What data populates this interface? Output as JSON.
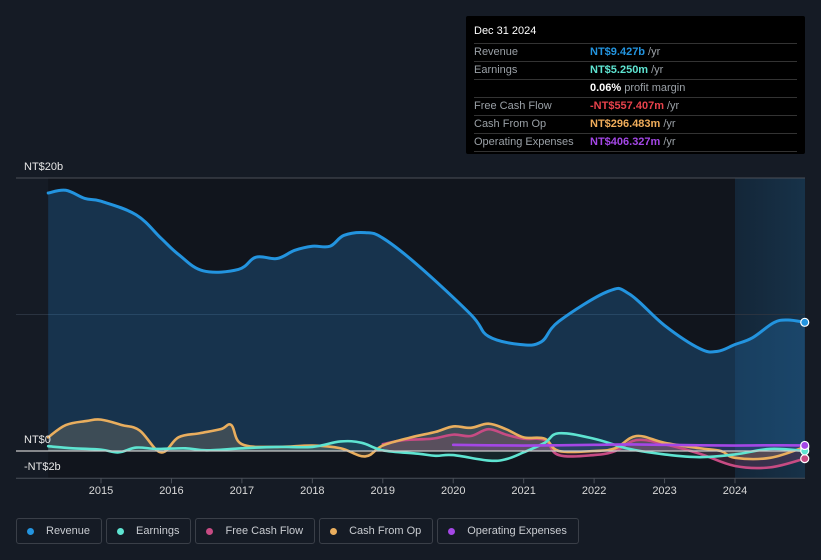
{
  "tooltip": {
    "date": "Dec 31 2024",
    "rows": [
      {
        "label": "Revenue",
        "value": "NT$9.427b",
        "unit": "/yr",
        "color": "#2394df"
      },
      {
        "label": "Earnings",
        "value": "NT$5.250m",
        "unit": "/yr",
        "color": "#5ee4d1"
      },
      {
        "label": "",
        "value": "0.06%",
        "unit": "profit margin",
        "color": "#ffffff"
      },
      {
        "label": "Free Cash Flow",
        "value": "-NT$557.407m",
        "unit": "/yr",
        "color": "#e8424b"
      },
      {
        "label": "Cash From Op",
        "value": "NT$296.483m",
        "unit": "/yr",
        "color": "#f0ad5b"
      },
      {
        "label": "Operating Expenses",
        "value": "NT$406.327m",
        "unit": "/yr",
        "color": "#a447e6"
      }
    ]
  },
  "legend": [
    {
      "label": "Revenue",
      "color": "#2394df"
    },
    {
      "label": "Earnings",
      "color": "#5ee4d1"
    },
    {
      "label": "Free Cash Flow",
      "color": "#c74b83"
    },
    {
      "label": "Cash From Op",
      "color": "#e9ae5e"
    },
    {
      "label": "Operating Expenses",
      "color": "#a447e6"
    }
  ],
  "chart_data": {
    "type": "line",
    "title": "",
    "xlabel": "",
    "ylabel": "",
    "unit": "NT$ billions",
    "xlim": [
      2014.25,
      2025.0
    ],
    "ylim": [
      -2,
      20
    ],
    "y_tick_labels": [
      {
        "value": 20,
        "label": "NT$20b"
      },
      {
        "value": 0,
        "label": "NT$0"
      },
      {
        "value": -2,
        "label": "-NT$2b"
      }
    ],
    "x_ticks": [
      2015,
      2016,
      2017,
      2018,
      2019,
      2020,
      2021,
      2022,
      2023,
      2024
    ],
    "x_tick_labels": [
      "2015",
      "2016",
      "2017",
      "2018",
      "2019",
      "2020",
      "2021",
      "2022",
      "2023",
      "2024"
    ],
    "grid": true,
    "legend_position": "bottom",
    "highlight_start": 2024.0,
    "series": [
      {
        "name": "Revenue",
        "color": "#2394df",
        "fill": true,
        "x": [
          2014.25,
          2014.5,
          2014.77,
          2015.0,
          2015.5,
          2015.85,
          2016.1,
          2016.45,
          2016.95,
          2017.2,
          2017.5,
          2017.75,
          2018.0,
          2018.25,
          2018.45,
          2018.75,
          2019.0,
          2019.5,
          2020.25,
          2020.5,
          2020.95,
          2021.25,
          2021.5,
          2022.2,
          2022.5,
          2023.0,
          2023.5,
          2023.75,
          2024.0,
          2024.25,
          2024.55,
          2024.75,
          2024.99
        ],
        "values": [
          18.9,
          19.1,
          18.5,
          18.3,
          17.3,
          15.6,
          14.4,
          13.2,
          13.3,
          14.2,
          14.1,
          14.7,
          15.0,
          15.0,
          15.8,
          16.0,
          15.6,
          13.6,
          10.0,
          8.4,
          7.8,
          8.0,
          9.5,
          11.7,
          11.5,
          9.2,
          7.5,
          7.3,
          7.8,
          8.3,
          9.4,
          9.6,
          9.427
        ]
      },
      {
        "name": "Earnings",
        "color": "#5ee4d1",
        "fill": false,
        "x": [
          2014.25,
          2014.6,
          2015.0,
          2015.25,
          2015.5,
          2015.8,
          2016.2,
          2016.5,
          2017.0,
          2017.5,
          2018.0,
          2018.4,
          2018.7,
          2019.0,
          2019.5,
          2019.75,
          2020.0,
          2020.5,
          2020.75,
          2021.0,
          2021.3,
          2021.5,
          2022.0,
          2022.5,
          2023.0,
          2023.5,
          2024.0,
          2024.5,
          2024.99
        ],
        "values": [
          0.35,
          0.2,
          0.1,
          -0.1,
          0.25,
          0.15,
          0.2,
          0.05,
          0.2,
          0.3,
          0.3,
          0.7,
          0.6,
          0.05,
          -0.2,
          -0.35,
          -0.3,
          -0.7,
          -0.6,
          -0.1,
          0.6,
          1.3,
          0.9,
          0.15,
          -0.25,
          -0.45,
          -0.25,
          0.15,
          0.005
        ]
      },
      {
        "name": "Free Cash Flow",
        "color": "#c74b83",
        "fill": false,
        "x": [
          2019.0,
          2019.3,
          2019.7,
          2020.0,
          2020.25,
          2020.5,
          2020.75,
          2021.0,
          2021.3,
          2021.5,
          2022.0,
          2022.3,
          2022.6,
          2023.0,
          2023.5,
          2024.0,
          2024.5,
          2024.99
        ],
        "values": [
          0.5,
          0.8,
          0.9,
          1.2,
          1.1,
          1.6,
          1.2,
          0.9,
          0.8,
          -0.3,
          -0.3,
          0.0,
          0.8,
          0.5,
          -0.2,
          -1.1,
          -1.2,
          -0.557
        ]
      },
      {
        "name": "Cash From Op",
        "color": "#e9ae5e",
        "fill": false,
        "x": [
          2014.25,
          2014.5,
          2014.8,
          2015.0,
          2015.3,
          2015.55,
          2015.85,
          2016.1,
          2016.4,
          2016.7,
          2016.85,
          2017.0,
          2017.5,
          2018.0,
          2018.4,
          2018.75,
          2019.0,
          2019.4,
          2019.75,
          2020.0,
          2020.25,
          2020.5,
          2020.75,
          2021.0,
          2021.3,
          2021.5,
          2022.0,
          2022.3,
          2022.6,
          2023.0,
          2023.5,
          2023.8,
          2024.0,
          2024.5,
          2024.99
        ],
        "values": [
          1.0,
          1.9,
          2.2,
          2.3,
          1.9,
          1.5,
          -0.1,
          1.0,
          1.3,
          1.6,
          1.9,
          0.5,
          0.3,
          0.4,
          0.2,
          -0.4,
          0.4,
          1.0,
          1.4,
          1.8,
          1.7,
          2.0,
          1.6,
          1.0,
          0.9,
          0.0,
          0.0,
          0.2,
          1.1,
          0.6,
          0.2,
          0.0,
          -0.5,
          -0.5,
          0.296
        ]
      },
      {
        "name": "Operating Expenses",
        "color": "#a447e6",
        "fill": false,
        "x": [
          2020.0,
          2020.5,
          2021.0,
          2021.5,
          2022.0,
          2022.5,
          2023.0,
          2023.5,
          2024.0,
          2024.5,
          2024.99
        ],
        "values": [
          0.45,
          0.42,
          0.4,
          0.42,
          0.45,
          0.48,
          0.45,
          0.42,
          0.4,
          0.42,
          0.406
        ]
      }
    ]
  }
}
